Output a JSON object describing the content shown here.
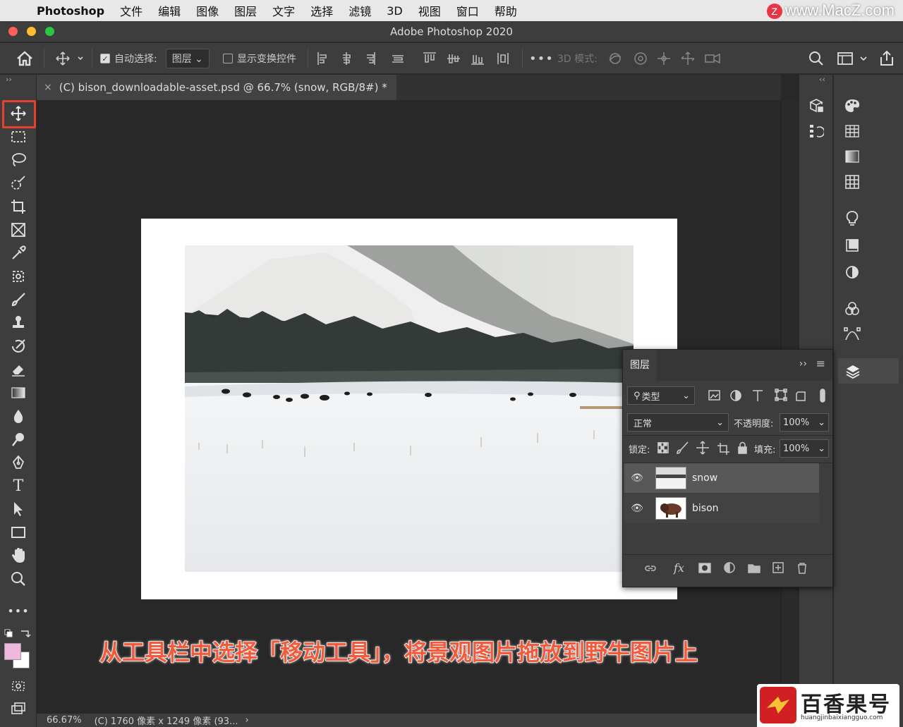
{
  "menubar": {
    "app_name": "Photoshop",
    "items": [
      "文件",
      "编辑",
      "图像",
      "图层",
      "文字",
      "选择",
      "滤镜",
      "3D",
      "视图",
      "窗口",
      "帮助"
    ],
    "watermark": "www.MacZ.com"
  },
  "window": {
    "title": "Adobe Photoshop 2020"
  },
  "options_bar": {
    "auto_select_label": "自动选择:",
    "auto_select_checked": true,
    "auto_select_target": "图层",
    "show_transform_label": "显示变换控件",
    "show_transform_checked": false,
    "mode_3d_label": "3D 模式:"
  },
  "document": {
    "tab_title": "(C) bison_downloadable-asset.psd @ 66.7% (snow, RGB/8#) *",
    "zoom": "66.67%",
    "info": "(C) 1760 像素 x 1249 像素 (93..."
  },
  "layers_panel": {
    "title": "图层",
    "filter_label": "类型",
    "blend_mode": "正常",
    "opacity_label": "不透明度:",
    "opacity_value": "100%",
    "lock_label": "锁定:",
    "fill_label": "填充:",
    "fill_value": "100%",
    "layers": [
      {
        "name": "snow",
        "selected": true,
        "visible": true
      },
      {
        "name": "bison",
        "selected": false,
        "visible": true
      }
    ]
  },
  "caption": "从工具栏中选择「移动工具」，将景观图片拖放到野牛图片上",
  "logo": {
    "name": "百香果号",
    "url": "huangjinbaixiangguo.com"
  },
  "colors": {
    "highlight": "#e8402e",
    "foreground": "#f0b8dc",
    "background": "#ffffff"
  }
}
